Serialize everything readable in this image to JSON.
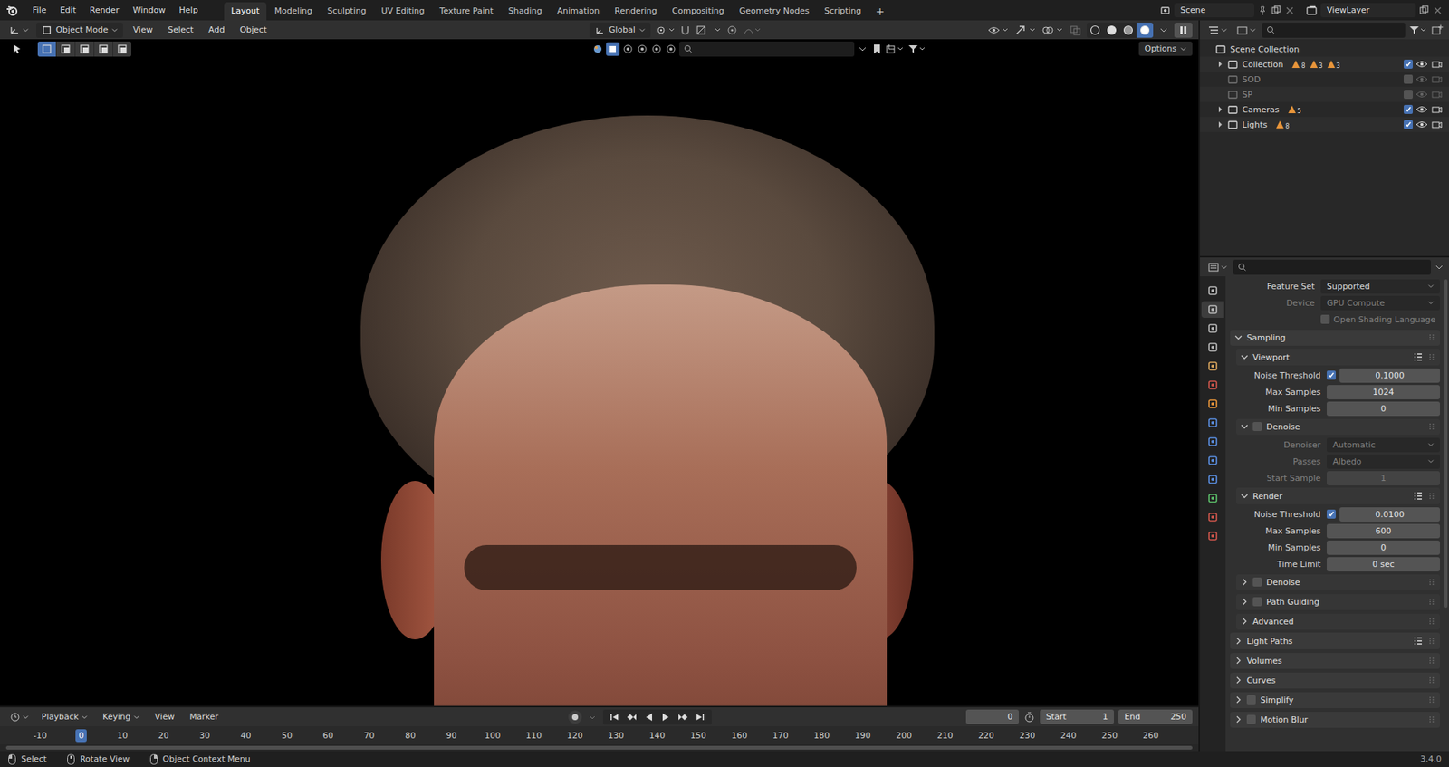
{
  "topbar": {
    "menus": [
      "File",
      "Edit",
      "Render",
      "Window",
      "Help"
    ],
    "workspaces": [
      {
        "label": "Layout",
        "selected": true
      },
      {
        "label": "Modeling",
        "selected": false
      },
      {
        "label": "Sculpting",
        "selected": false
      },
      {
        "label": "UV Editing",
        "selected": false
      },
      {
        "label": "Texture Paint",
        "selected": false
      },
      {
        "label": "Shading",
        "selected": false
      },
      {
        "label": "Animation",
        "selected": false
      },
      {
        "label": "Rendering",
        "selected": false
      },
      {
        "label": "Compositing",
        "selected": false
      },
      {
        "label": "Geometry Nodes",
        "selected": false
      },
      {
        "label": "Scripting",
        "selected": false
      }
    ],
    "add_workspace": "+",
    "scene": "Scene",
    "view_layer": "ViewLayer"
  },
  "viewport_header": {
    "mode": "Object Mode",
    "menus": [
      "View",
      "Select",
      "Add",
      "Object"
    ],
    "orientation": "Global",
    "shading": [
      {
        "mode": "wireframe",
        "selected": false
      },
      {
        "mode": "solid",
        "selected": false
      },
      {
        "mode": "material",
        "selected": false
      },
      {
        "mode": "rendered",
        "selected": true
      }
    ]
  },
  "tool_header": {
    "select_modes": [
      {
        "selected": true
      },
      {
        "selected": false
      },
      {
        "selected": false
      },
      {
        "selected": false
      },
      {
        "selected": false
      }
    ],
    "options": "Options"
  },
  "outliner": {
    "root": "Scene Collection",
    "items": [
      {
        "name": "Collection",
        "has_children": true,
        "expanded": false,
        "included": true,
        "counts": [
          "8",
          "3",
          "3"
        ]
      },
      {
        "name": "SOD",
        "has_children": false,
        "expanded": false,
        "included": false,
        "counts": []
      },
      {
        "name": "SP",
        "has_children": false,
        "expanded": false,
        "included": false,
        "counts": []
      },
      {
        "name": "Cameras",
        "has_children": true,
        "expanded": false,
        "included": true,
        "counts": [
          "5"
        ]
      },
      {
        "name": "Lights",
        "has_children": true,
        "expanded": false,
        "included": true,
        "counts": [
          "8"
        ]
      }
    ]
  },
  "properties": {
    "tabs": [
      {
        "icon": "tool",
        "selected": false
      },
      {
        "icon": "render",
        "selected": true
      },
      {
        "icon": "output",
        "selected": false
      },
      {
        "icon": "view-layer",
        "selected": false
      },
      {
        "icon": "scene",
        "selected": false
      },
      {
        "icon": "world",
        "selected": false
      },
      {
        "icon": "object",
        "selected": false
      },
      {
        "icon": "modifier",
        "selected": false
      },
      {
        "icon": "particles",
        "selected": false
      },
      {
        "icon": "physics",
        "selected": false
      },
      {
        "icon": "constraints",
        "selected": false
      },
      {
        "icon": "data",
        "selected": false
      },
      {
        "icon": "material",
        "selected": false
      },
      {
        "icon": "texture",
        "selected": false
      }
    ],
    "rows": [
      {
        "kind": "dropdown",
        "label": "Feature Set",
        "value": "Supported",
        "disabled": false,
        "depth": 0
      },
      {
        "kind": "dropdown",
        "label": "Device",
        "value": "GPU Compute",
        "disabled": true,
        "depth": 0
      },
      {
        "kind": "check",
        "label": "Open Shading Language",
        "checked": false,
        "disabled": true,
        "depth": 0
      },
      {
        "kind": "panel",
        "label": "Sampling",
        "expanded": true,
        "presets": false,
        "depth": 0
      },
      {
        "kind": "panel",
        "label": "Viewport",
        "expanded": true,
        "presets": true,
        "depth": 1
      },
      {
        "kind": "number",
        "label": "Noise Threshold",
        "value": "0.1000",
        "checked": true,
        "disabled": false,
        "depth": 2
      },
      {
        "kind": "number",
        "label": "Max Samples",
        "value": "1024",
        "disabled": false,
        "depth": 2
      },
      {
        "kind": "number",
        "label": "Min Samples",
        "value": "0",
        "disabled": false,
        "depth": 2
      },
      {
        "kind": "panel",
        "label": "Denoise",
        "expanded": true,
        "presets": false,
        "checked": false,
        "depth": 1
      },
      {
        "kind": "dropdown",
        "label": "Denoiser",
        "value": "Automatic",
        "disabled": true,
        "depth": 2
      },
      {
        "kind": "dropdown",
        "label": "Passes",
        "value": "Albedo",
        "disabled": true,
        "depth": 2
      },
      {
        "kind": "number",
        "label": "Start Sample",
        "value": "1",
        "disabled": true,
        "depth": 2
      },
      {
        "kind": "panel",
        "label": "Render",
        "expanded": true,
        "presets": true,
        "depth": 1
      },
      {
        "kind": "number",
        "label": "Noise Threshold",
        "value": "0.0100",
        "checked": true,
        "disabled": false,
        "depth": 2
      },
      {
        "kind": "number",
        "label": "Max Samples",
        "value": "600",
        "disabled": false,
        "depth": 2
      },
      {
        "kind": "number",
        "label": "Min Samples",
        "value": "0",
        "disabled": false,
        "depth": 2
      },
      {
        "kind": "number",
        "label": "Time Limit",
        "value": "0 sec",
        "disabled": false,
        "depth": 2
      },
      {
        "kind": "panel",
        "label": "Denoise",
        "expanded": false,
        "presets": false,
        "checked": false,
        "depth": 1
      },
      {
        "kind": "panel",
        "label": "Path Guiding",
        "expanded": false,
        "presets": false,
        "checked": false,
        "depth": 1
      },
      {
        "kind": "panel",
        "label": "Advanced",
        "expanded": false,
        "presets": false,
        "depth": 1
      },
      {
        "kind": "panel",
        "label": "Light Paths",
        "expanded": false,
        "presets": true,
        "depth": 0
      },
      {
        "kind": "panel",
        "label": "Volumes",
        "expanded": false,
        "presets": false,
        "depth": 0
      },
      {
        "kind": "panel",
        "label": "Curves",
        "expanded": false,
        "presets": false,
        "depth": 0
      },
      {
        "kind": "panel",
        "label": "Simplify",
        "expanded": false,
        "presets": false,
        "checked": false,
        "depth": 0
      },
      {
        "kind": "panel",
        "label": "Motion Blur",
        "expanded": false,
        "presets": false,
        "checked": false,
        "depth": 0
      }
    ]
  },
  "timeline": {
    "menus": [
      {
        "label": "Playback",
        "dropdown": true
      },
      {
        "label": "Keying",
        "dropdown": true
      },
      {
        "label": "View",
        "dropdown": false
      },
      {
        "label": "Marker",
        "dropdown": false
      }
    ],
    "current_frame": "0",
    "start_label": "Start",
    "start": "1",
    "end_label": "End",
    "end": "250",
    "ticks": [
      {
        "label": "-10",
        "selected": false
      },
      {
        "label": "0",
        "selected": true
      },
      {
        "label": "10",
        "selected": false
      },
      {
        "label": "20",
        "selected": false
      },
      {
        "label": "30",
        "selected": false
      },
      {
        "label": "40",
        "selected": false
      },
      {
        "label": "50",
        "selected": false
      },
      {
        "label": "60",
        "selected": false
      },
      {
        "label": "70",
        "selected": false
      },
      {
        "label": "80",
        "selected": false
      },
      {
        "label": "90",
        "selected": false
      },
      {
        "label": "100",
        "selected": false
      },
      {
        "label": "110",
        "selected": false
      },
      {
        "label": "120",
        "selected": false
      },
      {
        "label": "130",
        "selected": false
      },
      {
        "label": "140",
        "selected": false
      },
      {
        "label": "150",
        "selected": false
      },
      {
        "label": "160",
        "selected": false
      },
      {
        "label": "170",
        "selected": false
      },
      {
        "label": "180",
        "selected": false
      },
      {
        "label": "190",
        "selected": false
      },
      {
        "label": "200",
        "selected": false
      },
      {
        "label": "210",
        "selected": false
      },
      {
        "label": "220",
        "selected": false
      },
      {
        "label": "230",
        "selected": false
      },
      {
        "label": "240",
        "selected": false
      },
      {
        "label": "250",
        "selected": false
      },
      {
        "label": "260",
        "selected": false
      }
    ]
  },
  "status_bar": {
    "hints": [
      {
        "label": "Select",
        "mouse": "left"
      },
      {
        "label": "Rotate View",
        "mouse": "middle"
      },
      {
        "label": "Object Context Menu",
        "mouse": "right"
      }
    ],
    "version": "3.4.0"
  }
}
